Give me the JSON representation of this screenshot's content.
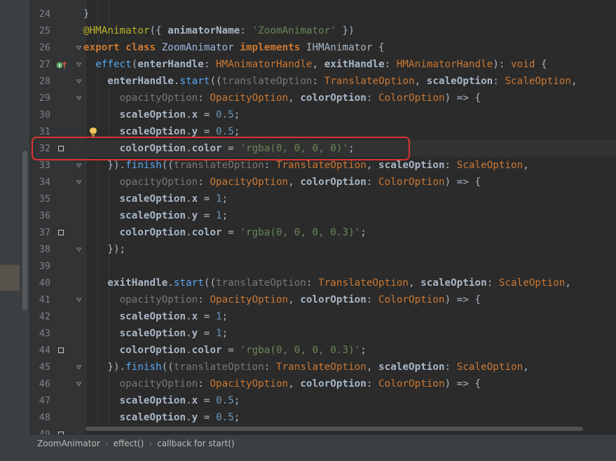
{
  "editor": {
    "lines": [
      {
        "num": "24",
        "tokens": [
          {
            "t": "}",
            "c": "plain"
          }
        ]
      },
      {
        "num": "25",
        "tokens": [
          {
            "t": "@HMAnimator",
            "c": "an"
          },
          {
            "t": "({ ",
            "c": "plain"
          },
          {
            "t": "animatorName",
            "c": "pm"
          },
          {
            "t": ": ",
            "c": "plain"
          },
          {
            "t": "'ZoomAnimator'",
            "c": "st"
          },
          {
            "t": " })",
            "c": "plain"
          }
        ]
      },
      {
        "num": "26",
        "tokens": [
          {
            "t": "export class ",
            "c": "kw"
          },
          {
            "t": "ZoomAnimator ",
            "c": "cls"
          },
          {
            "t": "implements ",
            "c": "kw"
          },
          {
            "t": "IHMAnimator ",
            "c": "plain"
          },
          {
            "t": "{",
            "c": "plain"
          }
        ]
      },
      {
        "num": "27",
        "tokens": [
          {
            "t": "  ",
            "c": "plain"
          },
          {
            "t": "effect",
            "c": "fn"
          },
          {
            "t": "(",
            "c": "plain"
          },
          {
            "t": "enterHandle",
            "c": "pm"
          },
          {
            "t": ": ",
            "c": "plain"
          },
          {
            "t": "HMAnimatorHandle",
            "c": "ty"
          },
          {
            "t": ", ",
            "c": "plain"
          },
          {
            "t": "exitHandle",
            "c": "pm"
          },
          {
            "t": ": ",
            "c": "plain"
          },
          {
            "t": "HMAnimatorHandle",
            "c": "ty"
          },
          {
            "t": "): ",
            "c": "plain"
          },
          {
            "t": "void",
            "c": "ty"
          },
          {
            "t": " {",
            "c": "plain"
          }
        ]
      },
      {
        "num": "28",
        "tokens": [
          {
            "t": "    ",
            "c": "plain"
          },
          {
            "t": "enterHandle",
            "c": "pm"
          },
          {
            "t": ".",
            "c": "plain"
          },
          {
            "t": "start",
            "c": "fn"
          },
          {
            "t": "((",
            "c": "plain"
          },
          {
            "t": "translateOption",
            "c": "dim"
          },
          {
            "t": ": ",
            "c": "plain"
          },
          {
            "t": "TranslateOption",
            "c": "ty"
          },
          {
            "t": ", ",
            "c": "plain"
          },
          {
            "t": "scaleOption",
            "c": "pm"
          },
          {
            "t": ": ",
            "c": "plain"
          },
          {
            "t": "ScaleOption",
            "c": "ty"
          },
          {
            "t": ",",
            "c": "plain"
          }
        ]
      },
      {
        "num": "29",
        "tokens": [
          {
            "t": "      ",
            "c": "plain"
          },
          {
            "t": "opacityOption",
            "c": "dim"
          },
          {
            "t": ": ",
            "c": "plain"
          },
          {
            "t": "OpacityOption",
            "c": "ty"
          },
          {
            "t": ", ",
            "c": "plain"
          },
          {
            "t": "colorOption",
            "c": "pm"
          },
          {
            "t": ": ",
            "c": "plain"
          },
          {
            "t": "ColorOption",
            "c": "ty"
          },
          {
            "t": ") => {",
            "c": "plain"
          }
        ]
      },
      {
        "num": "30",
        "tokens": [
          {
            "t": "      ",
            "c": "plain"
          },
          {
            "t": "scaleOption",
            "c": "pm"
          },
          {
            "t": ".",
            "c": "plain"
          },
          {
            "t": "x",
            "c": "pm"
          },
          {
            "t": " = ",
            "c": "plain"
          },
          {
            "t": "0.5",
            "c": "nm"
          },
          {
            "t": ";",
            "c": "plain"
          }
        ]
      },
      {
        "num": "31",
        "tokens": [
          {
            "t": "      ",
            "c": "plain"
          },
          {
            "t": "scaleOption",
            "c": "pm"
          },
          {
            "t": ".",
            "c": "plain"
          },
          {
            "t": "y",
            "c": "pm"
          },
          {
            "t": " = ",
            "c": "plain"
          },
          {
            "t": "0.5",
            "c": "nm"
          },
          {
            "t": ";",
            "c": "plain"
          }
        ]
      },
      {
        "num": "32",
        "current": true,
        "tokens": [
          {
            "t": "      ",
            "c": "plain"
          },
          {
            "t": "colorOption",
            "c": "pm"
          },
          {
            "t": ".",
            "c": "plain"
          },
          {
            "t": "color",
            "c": "pm"
          },
          {
            "t": " = ",
            "c": "plain"
          },
          {
            "t": "'rgba(0, 0, 0, 0)'",
            "c": "st"
          },
          {
            "t": ";",
            "c": "plain"
          }
        ]
      },
      {
        "num": "33",
        "tokens": [
          {
            "t": "    ",
            "c": "plain"
          },
          {
            "t": "}).",
            "c": "plain"
          },
          {
            "t": "finish",
            "c": "fn"
          },
          {
            "t": "((",
            "c": "plain"
          },
          {
            "t": "translateOption",
            "c": "dim"
          },
          {
            "t": ": ",
            "c": "plain"
          },
          {
            "t": "TranslateOption",
            "c": "ty"
          },
          {
            "t": ", ",
            "c": "plain"
          },
          {
            "t": "scaleOption",
            "c": "pm"
          },
          {
            "t": ": ",
            "c": "plain"
          },
          {
            "t": "ScaleOption",
            "c": "ty"
          },
          {
            "t": ",",
            "c": "plain"
          }
        ]
      },
      {
        "num": "34",
        "tokens": [
          {
            "t": "      ",
            "c": "plain"
          },
          {
            "t": "opacityOption",
            "c": "dim"
          },
          {
            "t": ": ",
            "c": "plain"
          },
          {
            "t": "OpacityOption",
            "c": "ty"
          },
          {
            "t": ", ",
            "c": "plain"
          },
          {
            "t": "colorOption",
            "c": "pm"
          },
          {
            "t": ": ",
            "c": "plain"
          },
          {
            "t": "ColorOption",
            "c": "ty"
          },
          {
            "t": ") => {",
            "c": "plain"
          }
        ]
      },
      {
        "num": "35",
        "tokens": [
          {
            "t": "      ",
            "c": "plain"
          },
          {
            "t": "scaleOption",
            "c": "pm"
          },
          {
            "t": ".",
            "c": "plain"
          },
          {
            "t": "x",
            "c": "pm"
          },
          {
            "t": " = ",
            "c": "plain"
          },
          {
            "t": "1",
            "c": "nm"
          },
          {
            "t": ";",
            "c": "plain"
          }
        ]
      },
      {
        "num": "36",
        "tokens": [
          {
            "t": "      ",
            "c": "plain"
          },
          {
            "t": "scaleOption",
            "c": "pm"
          },
          {
            "t": ".",
            "c": "plain"
          },
          {
            "t": "y",
            "c": "pm"
          },
          {
            "t": " = ",
            "c": "plain"
          },
          {
            "t": "1",
            "c": "nm"
          },
          {
            "t": ";",
            "c": "plain"
          }
        ]
      },
      {
        "num": "37",
        "tokens": [
          {
            "t": "      ",
            "c": "plain"
          },
          {
            "t": "colorOption",
            "c": "pm"
          },
          {
            "t": ".",
            "c": "plain"
          },
          {
            "t": "color",
            "c": "pm"
          },
          {
            "t": " = ",
            "c": "plain"
          },
          {
            "t": "'rgba(0, 0, 0, 0.3)'",
            "c": "st"
          },
          {
            "t": ";",
            "c": "plain"
          }
        ]
      },
      {
        "num": "38",
        "tokens": [
          {
            "t": "    ",
            "c": "plain"
          },
          {
            "t": "});",
            "c": "plain"
          }
        ]
      },
      {
        "num": "39",
        "tokens": []
      },
      {
        "num": "40",
        "tokens": [
          {
            "t": "    ",
            "c": "plain"
          },
          {
            "t": "exitHandle",
            "c": "pm"
          },
          {
            "t": ".",
            "c": "plain"
          },
          {
            "t": "start",
            "c": "fn"
          },
          {
            "t": "((",
            "c": "plain"
          },
          {
            "t": "translateOption",
            "c": "dim"
          },
          {
            "t": ": ",
            "c": "plain"
          },
          {
            "t": "TranslateOption",
            "c": "ty"
          },
          {
            "t": ", ",
            "c": "plain"
          },
          {
            "t": "scaleOption",
            "c": "pm"
          },
          {
            "t": ": ",
            "c": "plain"
          },
          {
            "t": "ScaleOption",
            "c": "ty"
          },
          {
            "t": ",",
            "c": "plain"
          }
        ]
      },
      {
        "num": "41",
        "tokens": [
          {
            "t": "      ",
            "c": "plain"
          },
          {
            "t": "opacityOption",
            "c": "dim"
          },
          {
            "t": ": ",
            "c": "plain"
          },
          {
            "t": "OpacityOption",
            "c": "ty"
          },
          {
            "t": ", ",
            "c": "plain"
          },
          {
            "t": "colorOption",
            "c": "pm"
          },
          {
            "t": ": ",
            "c": "plain"
          },
          {
            "t": "ColorOption",
            "c": "ty"
          },
          {
            "t": ") => {",
            "c": "plain"
          }
        ]
      },
      {
        "num": "42",
        "tokens": [
          {
            "t": "      ",
            "c": "plain"
          },
          {
            "t": "scaleOption",
            "c": "pm"
          },
          {
            "t": ".",
            "c": "plain"
          },
          {
            "t": "x",
            "c": "pm"
          },
          {
            "t": " = ",
            "c": "plain"
          },
          {
            "t": "1",
            "c": "nm"
          },
          {
            "t": ";",
            "c": "plain"
          }
        ]
      },
      {
        "num": "43",
        "tokens": [
          {
            "t": "      ",
            "c": "plain"
          },
          {
            "t": "scaleOption",
            "c": "pm"
          },
          {
            "t": ".",
            "c": "plain"
          },
          {
            "t": "y",
            "c": "pm"
          },
          {
            "t": " = ",
            "c": "plain"
          },
          {
            "t": "1",
            "c": "nm"
          },
          {
            "t": ";",
            "c": "plain"
          }
        ]
      },
      {
        "num": "44",
        "tokens": [
          {
            "t": "      ",
            "c": "plain"
          },
          {
            "t": "colorOption",
            "c": "pm"
          },
          {
            "t": ".",
            "c": "plain"
          },
          {
            "t": "color",
            "c": "pm"
          },
          {
            "t": " = ",
            "c": "plain"
          },
          {
            "t": "'rgba(0, 0, 0, 0.3)'",
            "c": "st"
          },
          {
            "t": ";",
            "c": "plain"
          }
        ]
      },
      {
        "num": "45",
        "tokens": [
          {
            "t": "    ",
            "c": "plain"
          },
          {
            "t": "}).",
            "c": "plain"
          },
          {
            "t": "finish",
            "c": "fn"
          },
          {
            "t": "((",
            "c": "plain"
          },
          {
            "t": "translateOption",
            "c": "dim"
          },
          {
            "t": ": ",
            "c": "plain"
          },
          {
            "t": "TranslateOption",
            "c": "ty"
          },
          {
            "t": ", ",
            "c": "plain"
          },
          {
            "t": "scaleOption",
            "c": "pm"
          },
          {
            "t": ": ",
            "c": "plain"
          },
          {
            "t": "ScaleOption",
            "c": "ty"
          },
          {
            "t": ",",
            "c": "plain"
          }
        ]
      },
      {
        "num": "46",
        "tokens": [
          {
            "t": "      ",
            "c": "plain"
          },
          {
            "t": "opacityOption",
            "c": "dim"
          },
          {
            "t": ": ",
            "c": "plain"
          },
          {
            "t": "OpacityOption",
            "c": "ty"
          },
          {
            "t": ", ",
            "c": "plain"
          },
          {
            "t": "colorOption",
            "c": "pm"
          },
          {
            "t": ": ",
            "c": "plain"
          },
          {
            "t": "ColorOption",
            "c": "ty"
          },
          {
            "t": ") => {",
            "c": "plain"
          }
        ]
      },
      {
        "num": "47",
        "tokens": [
          {
            "t": "      ",
            "c": "plain"
          },
          {
            "t": "scaleOption",
            "c": "pm"
          },
          {
            "t": ".",
            "c": "plain"
          },
          {
            "t": "x",
            "c": "pm"
          },
          {
            "t": " = ",
            "c": "plain"
          },
          {
            "t": "0.5",
            "c": "nm"
          },
          {
            "t": ";",
            "c": "plain"
          }
        ]
      },
      {
        "num": "48",
        "tokens": [
          {
            "t": "      ",
            "c": "plain"
          },
          {
            "t": "scaleOption",
            "c": "pm"
          },
          {
            "t": ".",
            "c": "plain"
          },
          {
            "t": "y",
            "c": "pm"
          },
          {
            "t": " = ",
            "c": "plain"
          },
          {
            "t": "0.5",
            "c": "nm"
          },
          {
            "t": ";",
            "c": "plain"
          }
        ]
      },
      {
        "num": "49",
        "tokens": []
      }
    ],
    "change_markers": [
      "32",
      "37",
      "44",
      "49"
    ],
    "fold_markers": [
      "26",
      "27",
      "28",
      "29",
      "33",
      "34",
      "38",
      "41",
      "45",
      "46"
    ],
    "highlight_line": "32",
    "icons": {
      "implements": "override-method-icon",
      "intention": "lightbulb-icon"
    }
  },
  "breadcrumb": {
    "items": [
      "ZoomAnimator",
      "effect()",
      "callback for start()"
    ],
    "separator": "›"
  },
  "colors": {
    "editor_bg": "#2b2b2b",
    "gutter_bg": "#313335",
    "annotation_box": "#d93433"
  }
}
